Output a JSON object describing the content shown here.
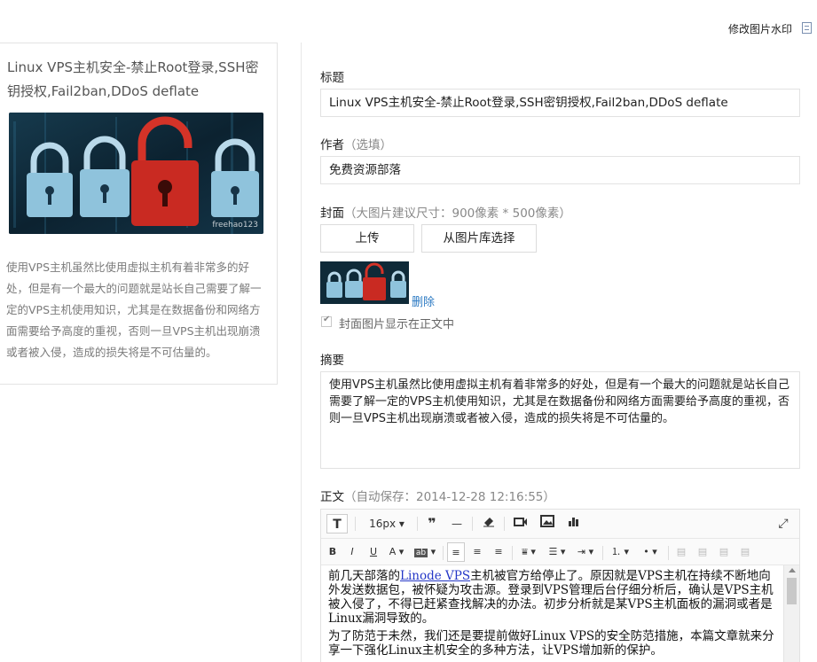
{
  "topbar": {
    "watermark_link": "修改图片水印",
    "watermark_icon": "document-icon"
  },
  "preview": {
    "title": "Linux VPS主机安全-禁止Root登录,SSH密钥授权,Fail2ban,DDoS deflate",
    "cover_watermark": "freehao123",
    "digest": "使用VPS主机虽然比使用虚拟主机有着非常多的好处，但是有一个最大的问题就是站长自己需要了解一定的VPS主机使用知识，尤其是在数据备份和网络方面需要给予高度的重视，否则一旦VPS主机出现崩溃或者被入侵，造成的损失将是不可估量的。"
  },
  "form": {
    "title_label": "标题",
    "title_value": "Linux VPS主机安全-禁止Root登录,SSH密钥授权,Fail2ban,DDoS deflate",
    "author_label": "作者",
    "author_hint": "（选填）",
    "author_value": "免费资源部落",
    "cover_label": "封面",
    "cover_hint": "（大图片建议尺寸：900像素 * 500像素）",
    "upload_button": "上传",
    "library_button": "从图片库选择",
    "delete_link": "删除",
    "show_cover_label": "封面图片显示在正文中",
    "show_cover_checked": true,
    "digest_label": "摘要",
    "digest_value": "使用VPS主机虽然比使用虚拟主机有着非常多的好处，但是有一个最大的问题就是站长自己需要了解一定的VPS主机使用知识，尤其是在数据备份和网络方面需要给予高度的重视，否则一旦VPS主机出现崩溃或者被入侵，造成的损失将是不可估量的。",
    "body_label": "正文",
    "autosave": "（自动保存：2014-12-28 12:16:55）"
  },
  "editor": {
    "font_size": "16px",
    "toolbar_icons": [
      "text-icon",
      "font-size-select",
      "quote-icon",
      "hr-icon",
      "eraser-icon",
      "video-icon",
      "image-icon",
      "chart-icon",
      "fullscreen-icon"
    ],
    "format_icons": [
      "bold-icon",
      "italic-icon",
      "underline-icon",
      "font-color-icon",
      "bg-color-icon",
      "align-left-icon",
      "align-center-icon",
      "align-right-icon",
      "row-spacing-icon",
      "line-height-icon",
      "indent-icon",
      "ordered-list-icon",
      "unordered-list-icon",
      "float-left-icon",
      "float-center-icon",
      "float-right-icon",
      "float-none-icon"
    ],
    "paragraph1_before": "前几天部落的",
    "paragraph1_link": "Linode VPS",
    "paragraph1_after": "主机被官方给停止了。原因就是VPS主机在持续不断地向外发送数据包，被怀疑为攻击源。登录到VPS管理后台仔细分析后，确认是VPS主机被入侵了，不得已赶紧查找解决的办法。初步分析就是某VPS主机面板的漏洞或者是Linux漏洞导致的。",
    "paragraph2": "为了防范于未然，我们还是要提前做好Linux VPS的安全防范措施，本篇文章就来分享一下强化Linux主机安全的多种方法，让VPS增加新的保护。"
  }
}
